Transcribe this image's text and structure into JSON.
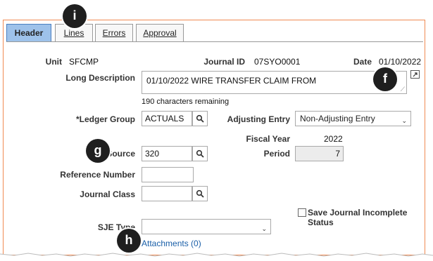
{
  "tabs": [
    {
      "label": "Header",
      "active": true
    },
    {
      "label": "Lines",
      "active": false
    },
    {
      "label": "Errors",
      "active": false
    },
    {
      "label": "Approval",
      "active": false
    }
  ],
  "header": {
    "unit_label": "Unit",
    "unit_value": "SFCMP",
    "journal_id_label": "Journal ID",
    "journal_id_value": "07SYO0001",
    "date_label": "Date",
    "date_value": "01/10/2022"
  },
  "form": {
    "long_description_label": "Long Description",
    "long_description_value": "01/10/2022 WIRE TRANSFER CLAIM FROM",
    "chars_remaining": "190 characters remaining",
    "ledger_group_label": "*Ledger Group",
    "ledger_group_value": "ACTUALS",
    "adjusting_entry_label": "Adjusting Entry",
    "adjusting_entry_value": "Non-Adjusting Entry",
    "fiscal_year_label": "Fiscal Year",
    "fiscal_year_value": "2022",
    "source_label": "*Source",
    "source_value": "320",
    "period_label": "Period",
    "period_value": "7",
    "reference_number_label": "Reference Number",
    "reference_number_value": "",
    "journal_class_label": "Journal Class",
    "journal_class_value": "",
    "save_incomplete_label": "Save Journal Incomplete Status",
    "sje_type_label": "SJE Type",
    "sje_type_value": "",
    "attachments_link": "Attachments (0)"
  },
  "callouts": {
    "i": "i",
    "f": "f",
    "g": "g",
    "h": "h"
  },
  "colors": {
    "accent_border": "#f08a52",
    "active_tab": "#9ec2ea",
    "link": "#1a5fa8"
  }
}
